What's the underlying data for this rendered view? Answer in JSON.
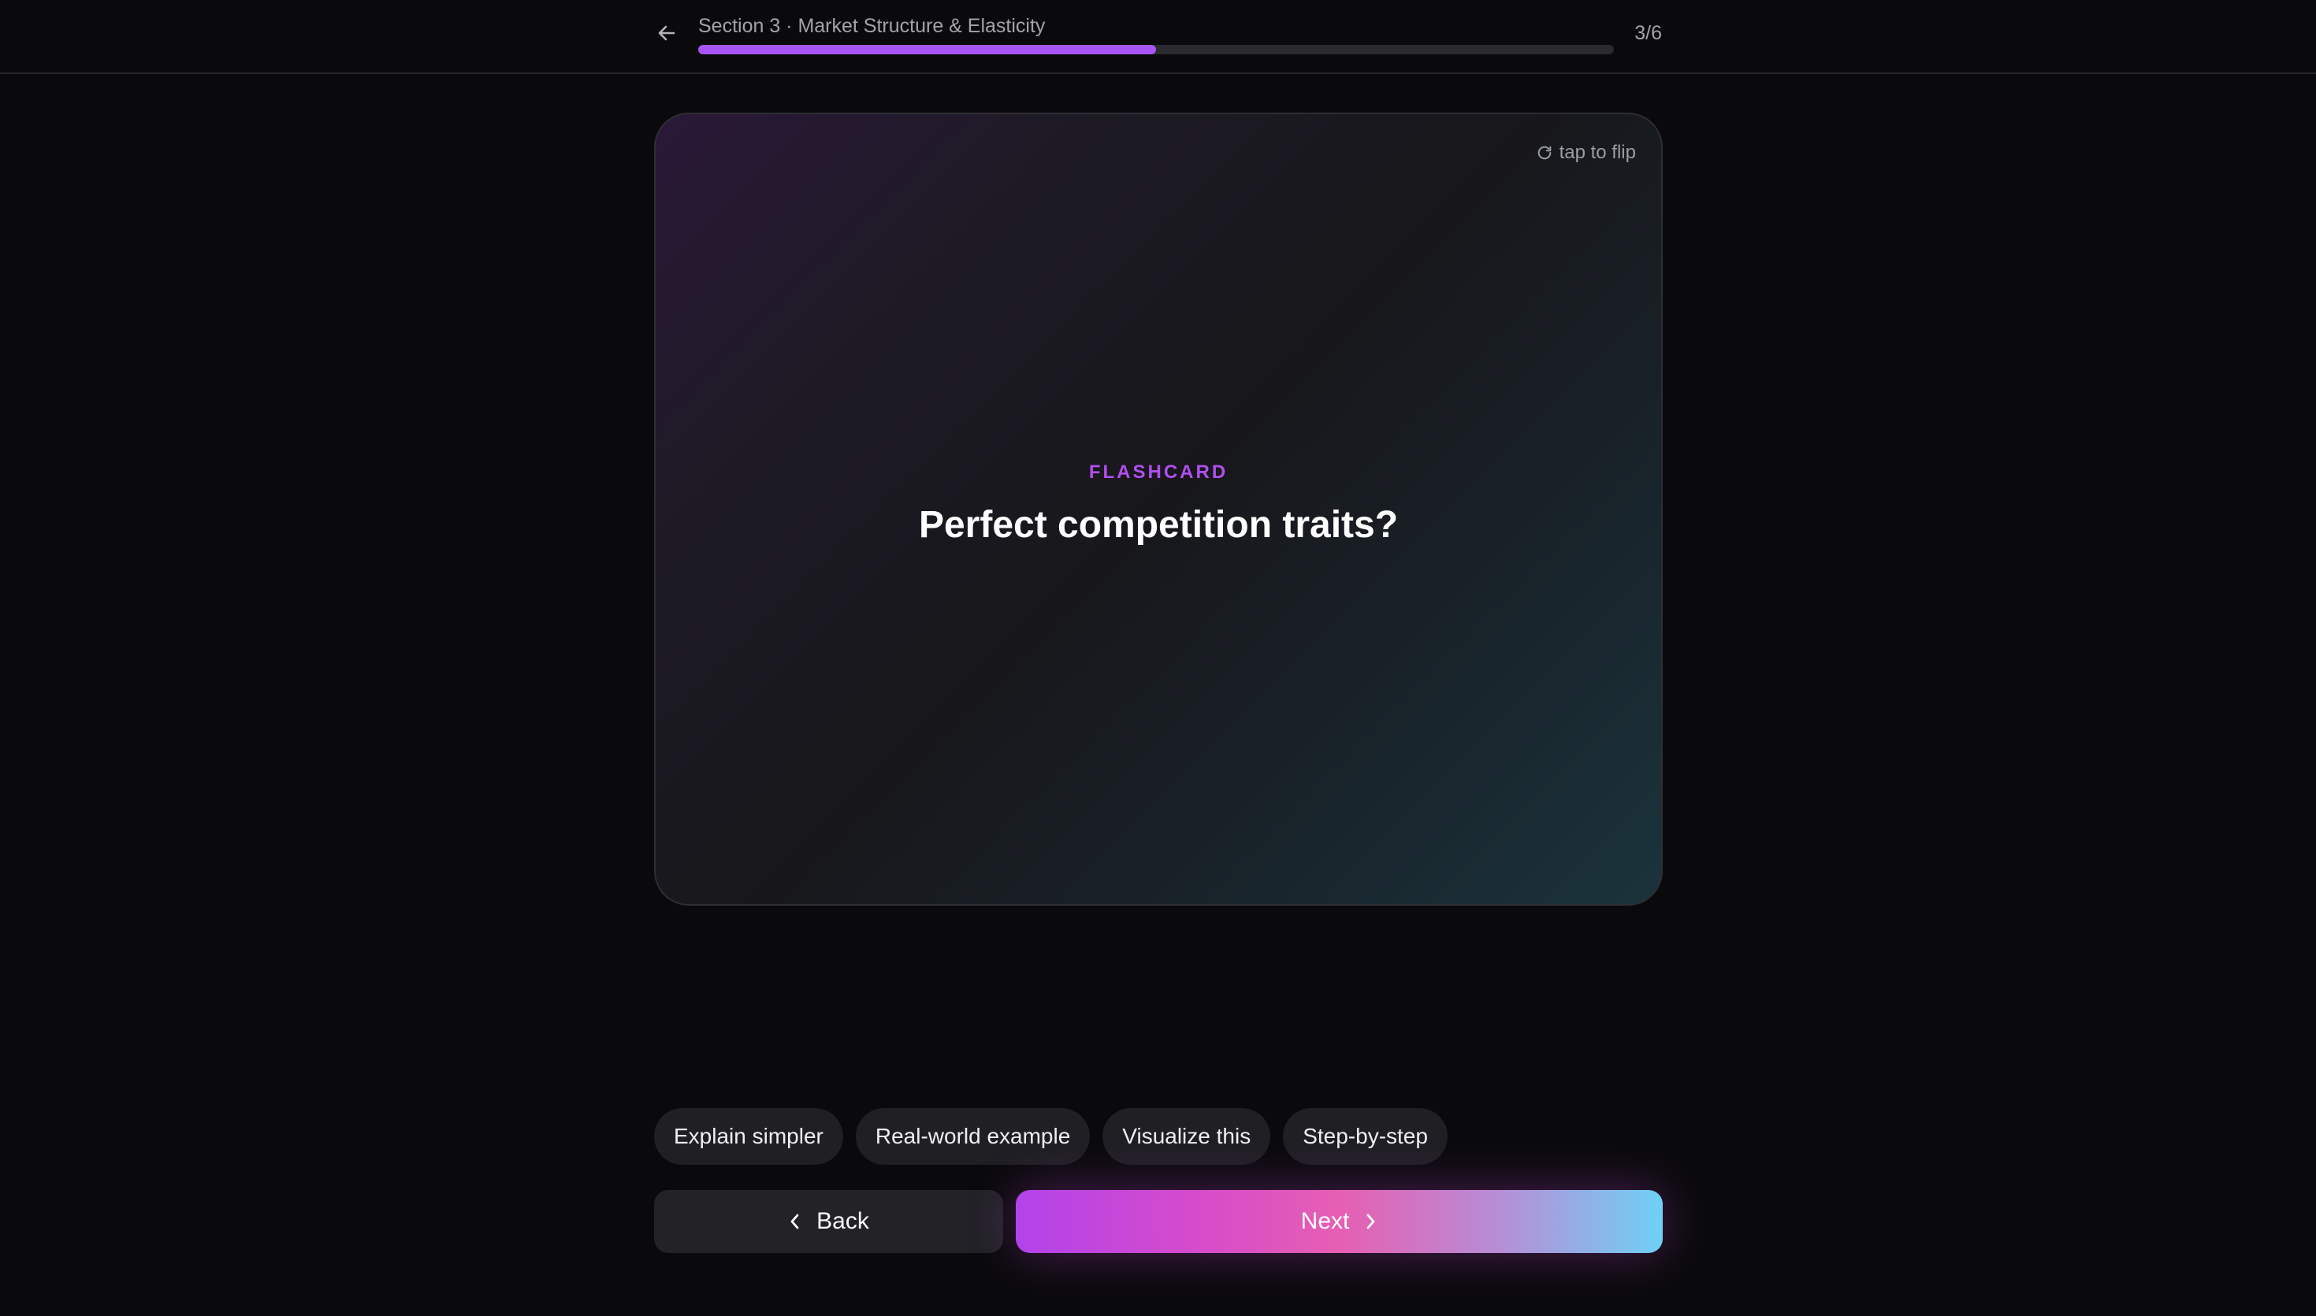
{
  "header": {
    "back_icon": "arrow-left-icon",
    "section_title": "Section 3 · Market Structure & Elasticity",
    "progress_fraction": 0.5,
    "step_counter": "3/6",
    "accent_color": "#a855f7"
  },
  "card": {
    "flip_icon": "rotate-icon",
    "flip_hint": "tap to flip",
    "kicker": "FLASHCARD",
    "question": "Perfect competition traits?"
  },
  "chips": [
    {
      "label": "Explain simpler"
    },
    {
      "label": "Real-world example"
    },
    {
      "label": "Visualize this"
    },
    {
      "label": "Step-by-step"
    }
  ],
  "nav": {
    "back_label": "Back",
    "back_icon": "chevron-left-icon",
    "next_label": "Next",
    "next_icon": "chevron-right-icon"
  }
}
